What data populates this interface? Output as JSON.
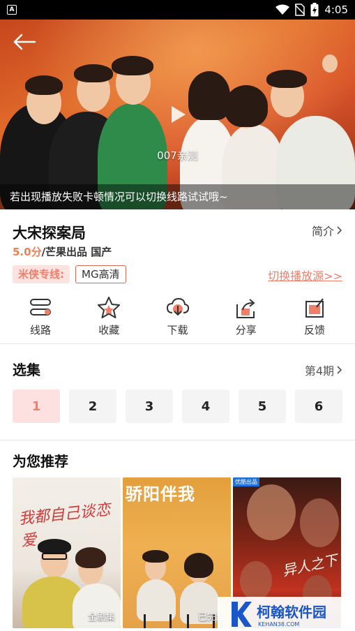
{
  "status_bar": {
    "app_indicator": "A",
    "time": "4:05",
    "icons": [
      "wifi-icon",
      "no-sim-icon",
      "battery-icon"
    ]
  },
  "player": {
    "overlay_label": "007亲测",
    "tip": "若出现播放失败卡顿情况可以切换线路试试哦~"
  },
  "show": {
    "title": "大宋探案局",
    "intro_label": "简介",
    "score": "5.0分",
    "meta": "/芒果出品 国产",
    "vip_line_label": "米侠专线:",
    "quality": "MG高清",
    "switch_source": "切换播放源>>"
  },
  "actions": [
    {
      "label": "线路",
      "icon": "route-icon"
    },
    {
      "label": "收藏",
      "icon": "star-icon"
    },
    {
      "label": "下载",
      "icon": "cloud-download-icon"
    },
    {
      "label": "分享",
      "icon": "share-icon"
    },
    {
      "label": "反馈",
      "icon": "feedback-icon"
    }
  ],
  "episodes": {
    "title": "选集",
    "current": "第4期",
    "items": [
      "1",
      "2",
      "3",
      "4",
      "5",
      "6"
    ],
    "active_index": 0
  },
  "recommendations": {
    "title": "为您推荐",
    "items": [
      {
        "poster_title": "我都自己谈恋爱",
        "tag": "全剧集"
      },
      {
        "poster_title": "骄阳伴我",
        "tag": "已完结"
      },
      {
        "poster_title": "异人之下",
        "tag": "",
        "badge": "优酷出品"
      }
    ]
  },
  "watermark": {
    "name": "柯翰软件园",
    "url": "KEHAN38.COM"
  },
  "colors": {
    "accent": "#f07f6a",
    "score": "#f07f56",
    "active_episode_bg": "#fde1e0",
    "watermark_blue": "#1a56c8"
  }
}
